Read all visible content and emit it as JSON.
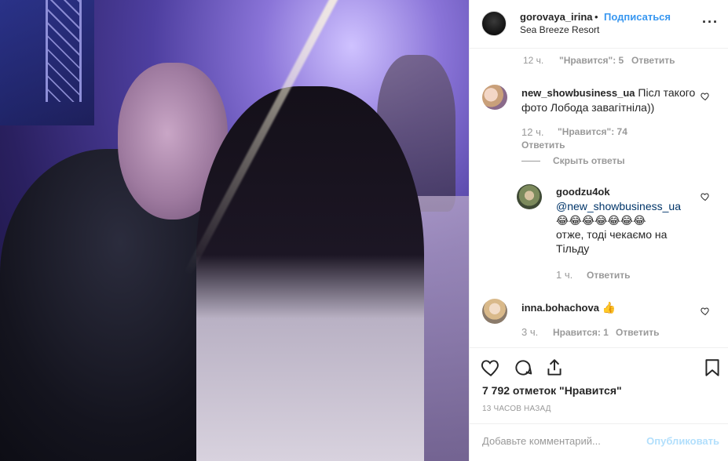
{
  "post": {
    "username": "gorovaya_irina",
    "separator": "•",
    "follow_label": "Подписаться",
    "location": "Sea Breeze Resort",
    "more_icon": "ellipsis-icon"
  },
  "comments": [
    {
      "id": "c0",
      "time": "12 ч.",
      "likes": "\"Нравится\": 5",
      "reply": "Ответить"
    },
    {
      "id": "c1",
      "username": "new_showbusiness_ua",
      "text": " Післ такого фото Лобода завагітніла))",
      "time": "12 ч.",
      "likes": "\"Нравится\": 74",
      "reply": "Ответить",
      "hide_replies": "Скрыть ответы"
    },
    {
      "id": "c2",
      "username": "goodzu4ok",
      "mention": "@new_showbusiness_ua",
      "emoji": "😂😂😂😂😂😂😂",
      "text": "отже, тоді чекаємо на Тільду",
      "time": "1 ч.",
      "reply": "Ответить"
    },
    {
      "id": "c3",
      "username": "inna.bohachova",
      "text": " 👍",
      "time": "3 ч.",
      "likes": "Нравится: 1",
      "reply": "Ответить"
    }
  ],
  "actions": {
    "likes_count": "7 792 отметок \"Нравится\"",
    "posted_ago": "13 ЧАСОВ НАЗАД",
    "comment_placeholder": "Добавьте комментарий...",
    "publish_label": "Опубликовать"
  },
  "colors": {
    "accent": "#3897f0",
    "muted": "#999999",
    "publish_disabled": "#b2dffc"
  }
}
